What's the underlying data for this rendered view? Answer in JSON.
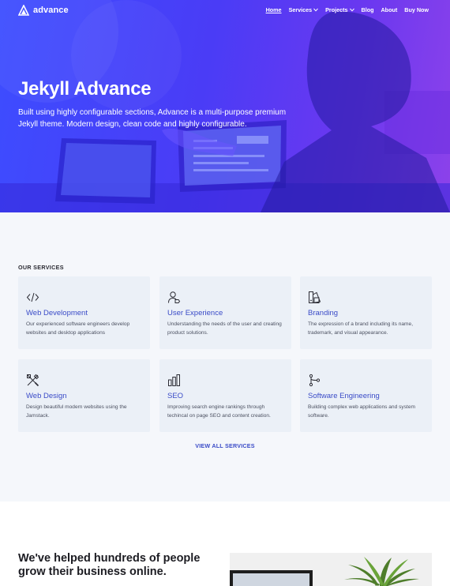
{
  "nav": {
    "logo_text": "advance",
    "items": [
      {
        "label": "Home",
        "dropdown": false,
        "active": true
      },
      {
        "label": "Services",
        "dropdown": true,
        "active": false
      },
      {
        "label": "Projects",
        "dropdown": true,
        "active": false
      },
      {
        "label": "Blog",
        "dropdown": false,
        "active": false
      },
      {
        "label": "About",
        "dropdown": false,
        "active": false
      },
      {
        "label": "Buy Now",
        "dropdown": false,
        "active": false
      }
    ]
  },
  "hero": {
    "title": "Jekyll Advance",
    "description": "Built using highly configurable sections, Advance is a multi-purpose premium Jekyll theme. Modern design, clean code and highly configurable."
  },
  "services": {
    "label": "OUR SERVICES",
    "cards": [
      {
        "icon": "code-icon",
        "title": "Web Development",
        "description": "Our experienced software engineers develop websites and desktop applications"
      },
      {
        "icon": "user-experience-icon",
        "title": "User Experience",
        "description": "Understanding the needs of the user and creating product solutions."
      },
      {
        "icon": "branding-icon",
        "title": "Branding",
        "description": "The expression of a brand including its name, trademark, and visual appearance."
      },
      {
        "icon": "design-tools-icon",
        "title": "Web Design",
        "description": "Design beautiful modern websites using the Jamstack."
      },
      {
        "icon": "bar-chart-icon",
        "title": "SEO",
        "description": "Improving search engine rankings through techincal on page SEO and content creation."
      },
      {
        "icon": "git-branch-icon",
        "title": "Software Engineering",
        "description": "Building complex web applications and system software."
      }
    ],
    "view_all": "VIEW ALL SERVICES"
  },
  "intro": {
    "headline": "We've helped hundreds of people grow their business online."
  },
  "colors": {
    "accent": "#3a4bc7",
    "hero_gradient_start": "#3d4dff",
    "hero_gradient_end": "#8d42ea",
    "card_bg": "#ebf0f7",
    "section_bg": "#f5f7fb"
  }
}
